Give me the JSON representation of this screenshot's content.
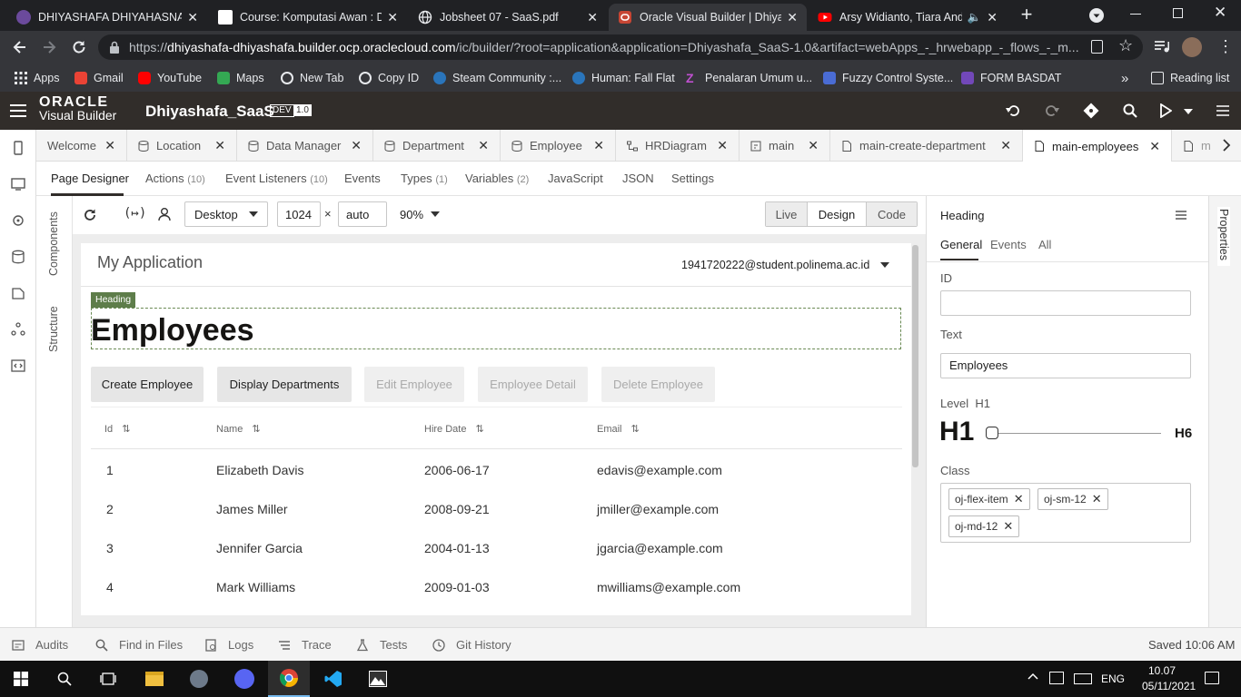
{
  "browser": {
    "tabs": [
      {
        "title": "DHIYASHAFA DHIYAHASNA H",
        "favicon": "university-logo-icon",
        "color": "#6b4a9c"
      },
      {
        "title": "Course: Komputasi Awan : Di",
        "favicon": "moodle-icon",
        "color": "#ffffff"
      },
      {
        "title": "Jobsheet 07 - SaaS.pdf",
        "favicon": "globe-icon",
        "color": "#9aa0a6"
      },
      {
        "title": "Oracle Visual Builder | Dhiyas",
        "favicon": "oracle-icon",
        "color": "#c74634"
      },
      {
        "title": "Arsy Widianto, Tiara Andi",
        "favicon": "youtube-icon",
        "color": "#ff0000"
      }
    ],
    "url_domain": "dhiyashafa-dhiyashafa.builder.ocp.oraclecloud.com",
    "url_prefix": "https://",
    "url_path": "/ic/builder/?root=application&application=Dhiyashafa_SaaS-1.0&artifact=webApps_-_hrwebapp_-_flows_-_m...",
    "bookmarks": [
      {
        "label": "Apps",
        "icon": "apps-grid-icon",
        "color": "#e8eaed"
      },
      {
        "label": "Gmail",
        "icon": "gmail-icon",
        "color": "#ea4335"
      },
      {
        "label": "YouTube",
        "icon": "youtube-icon",
        "color": "#ff0000"
      },
      {
        "label": "Maps",
        "icon": "maps-icon",
        "color": "#34a853"
      },
      {
        "label": "New Tab",
        "icon": "globe-icon",
        "color": "#9aa0a6"
      },
      {
        "label": "Copy ID",
        "icon": "globe-icon",
        "color": "#9aa0a6"
      },
      {
        "label": "Steam Community :...",
        "icon": "steam-icon",
        "color": "#1b2838"
      },
      {
        "label": "Human: Fall Flat",
        "icon": "steam-icon",
        "color": "#1b2838"
      },
      {
        "label": "Penalaran Umum u...",
        "icon": "z-logo-icon",
        "color": "#b040c0"
      },
      {
        "label": "Fuzzy Control Syste...",
        "icon": "skfuzzy-icon",
        "color": "#4a6cd4"
      },
      {
        "label": "FORM BASDAT",
        "icon": "forms-icon",
        "color": "#7248b9"
      }
    ],
    "reading_list": "Reading list"
  },
  "vb": {
    "oracle_label": "ORACLE",
    "product_label": "Visual Builder",
    "app_name": "Dhiyashafa_SaaS",
    "env_badge": "DEV",
    "version_badge": "1.0",
    "doc_tabs": [
      {
        "label": "Welcome",
        "icon": "none"
      },
      {
        "label": "Location",
        "icon": "database-icon"
      },
      {
        "label": "Data Manager",
        "icon": "database-icon"
      },
      {
        "label": "Department",
        "icon": "database-icon"
      },
      {
        "label": "Employee",
        "icon": "database-icon"
      },
      {
        "label": "HRDiagram",
        "icon": "diagram-icon"
      },
      {
        "label": "main",
        "icon": "flow-icon"
      },
      {
        "label": "main-create-department",
        "icon": "page-icon"
      },
      {
        "label": "main-employees",
        "icon": "page-icon"
      },
      {
        "label": "m",
        "icon": "page-icon"
      }
    ],
    "sub_nav": [
      {
        "label": "Page Designer",
        "count": ""
      },
      {
        "label": "Actions",
        "count": "(10)"
      },
      {
        "label": "Event Listeners",
        "count": "(10)"
      },
      {
        "label": "Events",
        "count": ""
      },
      {
        "label": "Types",
        "count": "(1)"
      },
      {
        "label": "Variables",
        "count": "(2)"
      },
      {
        "label": "JavaScript",
        "count": ""
      },
      {
        "label": "JSON",
        "count": ""
      },
      {
        "label": "Settings",
        "count": ""
      }
    ],
    "left_vertical_tabs": {
      "components": "Components",
      "structure": "Structure"
    },
    "toolbar": {
      "device": "Desktop",
      "width": "1024",
      "times": "×",
      "height": "auto",
      "zoom": "90%",
      "modes": [
        "Live",
        "Design",
        "Code"
      ],
      "active_mode": "Design"
    },
    "preview": {
      "app_title": "My Application",
      "user_email": "1941720222@student.polinema.ac.id",
      "selection_tag": "Heading",
      "heading": "Employees",
      "buttons": [
        {
          "label": "Create Employee",
          "enabled": true
        },
        {
          "label": "Display Departments",
          "enabled": true
        },
        {
          "label": "Edit Employee",
          "enabled": false
        },
        {
          "label": "Employee Detail",
          "enabled": false
        },
        {
          "label": "Delete Employee",
          "enabled": false
        }
      ],
      "table_headers": [
        "Id",
        "Name",
        "Hire Date",
        "Email"
      ],
      "sort_glyph": "⇅",
      "rows": [
        [
          "1",
          "Elizabeth Davis",
          "2006-06-17",
          "edavis@example.com"
        ],
        [
          "2",
          "James Miller",
          "2008-09-21",
          "jmiller@example.com"
        ],
        [
          "3",
          "Jennifer Garcia",
          "2004-01-13",
          "jgarcia@example.com"
        ],
        [
          "4",
          "Mark Williams",
          "2009-01-03",
          "mwilliams@example.com"
        ]
      ]
    },
    "properties": {
      "title": "Heading",
      "tabs": [
        "General",
        "Events",
        "All"
      ],
      "id_label": "ID",
      "id_value": "",
      "text_label": "Text",
      "text_value": "Employees",
      "level_label": "Level",
      "level_value": "H1",
      "level_min": "H1",
      "level_max": "H6",
      "class_label": "Class",
      "classes": [
        "oj-flex-item",
        "oj-sm-12",
        "oj-md-12"
      ],
      "side_tab": "Properties"
    },
    "bottom_bar": {
      "items": [
        "Audits",
        "Find in Files",
        "Logs",
        "Trace",
        "Tests",
        "Git History"
      ],
      "status": "Saved 10:06 AM"
    }
  },
  "taskbar": {
    "lang": "ENG",
    "time": "10.07",
    "date": "05/11/2021"
  },
  "colors": {
    "vb_header": "#312d2a",
    "heading_tag": "#5e7d4a",
    "chrome_dark": "#202124"
  }
}
